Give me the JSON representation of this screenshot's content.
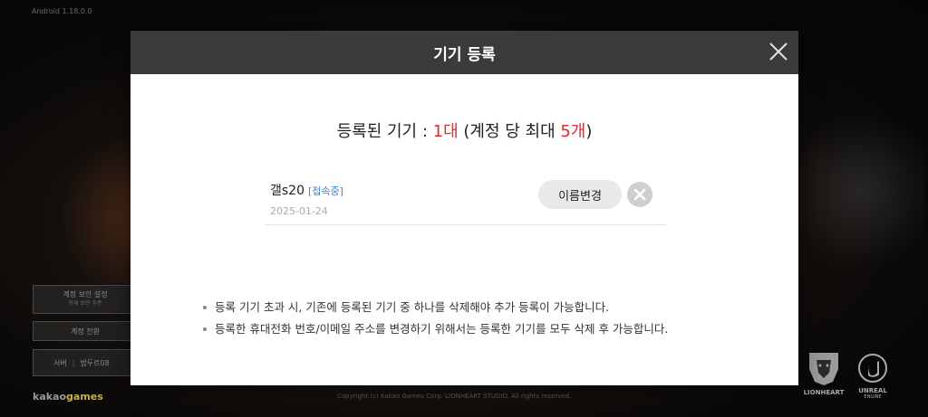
{
  "background": {
    "version": "Android 1.18.0.0",
    "side_buttons": {
      "security": {
        "label": "계정 보안 설정",
        "sub": "현재 보안 수준"
      },
      "switch_account": "계정 전환",
      "server": {
        "prefix": "서버",
        "separator": "|",
        "name": "밤두르08"
      }
    },
    "publisher": {
      "part1": "kakao",
      "part2": "games"
    },
    "copyright": "Copyright (c) Kakao Games Corp. LIONHEART STUDIO. All rights reserved.",
    "studio_logo": "LIONHEART",
    "engine_logo": {
      "line1": "UNREAL",
      "line2": "ENGINE"
    }
  },
  "modal": {
    "title": "기기 등록",
    "close_icon": "close-icon",
    "summary": {
      "prefix": "등록된 기기 : ",
      "count": "1대",
      "middle": " (계정 당 최대 ",
      "max": "5개",
      "suffix": ")"
    },
    "devices": [
      {
        "name": "갤s20",
        "status": "[접속중]",
        "date": "2025-01-24",
        "rename_label": "이름변경",
        "delete_icon": "delete-icon"
      }
    ],
    "notes": [
      "등록 기기 초과 시, 기존에 등록된 기기 중 하나를 삭제해야 추가 등록이 가능합니다.",
      "등록한 휴대전화 번호/이메일 주소를 변경하기 위해서는 등록한 기기를 모두 삭제 후 가능합니다."
    ]
  },
  "colors": {
    "header_bg": "#3b3b3b",
    "accent_red": "#e5282c",
    "status_blue": "#3a86d6"
  }
}
